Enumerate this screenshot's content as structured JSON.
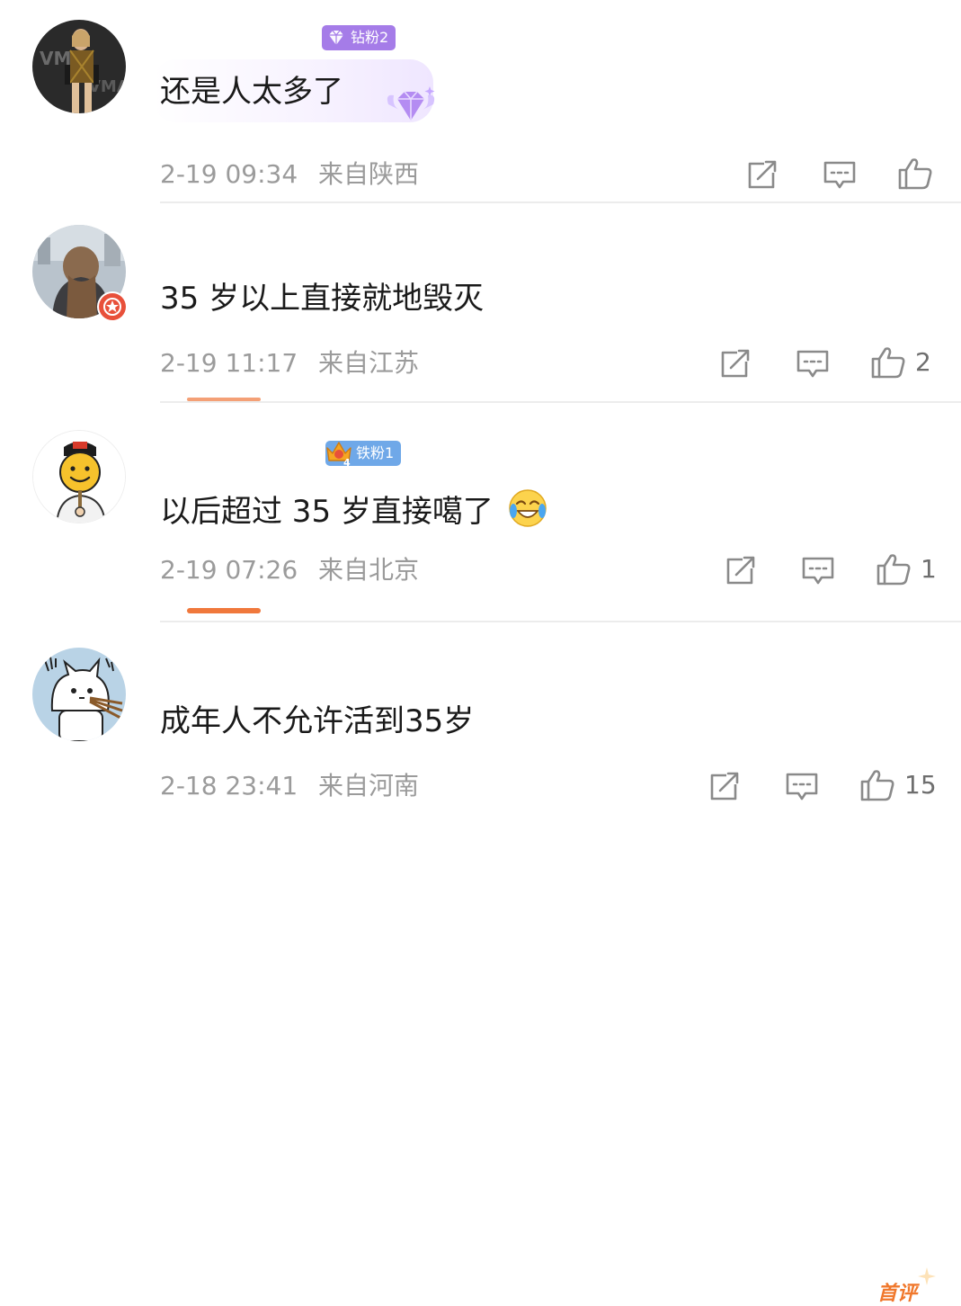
{
  "comments": [
    {
      "avatar": "avatar-taylor-vma",
      "fan_badge": {
        "label": "钻粉2",
        "icon": "diamond-icon",
        "color": "#a57ce8"
      },
      "text": "还是人太多了",
      "time": "2-19 09:34",
      "location": "来自陕西",
      "likes": ""
    },
    {
      "avatar": "avatar-girl-back",
      "text": "35 岁以上直接就地毁灭",
      "time": "2-19 11:17",
      "location": "来自江苏",
      "likes": "2"
    },
    {
      "avatar": "avatar-smiley-mask",
      "fan_badge": {
        "label": "铁粉1",
        "icon": "crown-icon",
        "color": "#6fa8e8"
      },
      "text": "以后超过 35 岁直接噶了",
      "time": "2-19 07:26",
      "location": "来自北京",
      "likes": "1"
    },
    {
      "avatar": "avatar-cat-cartoon",
      "tag": "首评",
      "text": "成年人不允许活到35岁",
      "time": "2-18 23:41",
      "location": "来自河南",
      "likes": "15"
    }
  ],
  "colors": {
    "meta": "#9b9b9b",
    "accent_orange": "#f0783c",
    "icon": "#8a8a8a"
  }
}
